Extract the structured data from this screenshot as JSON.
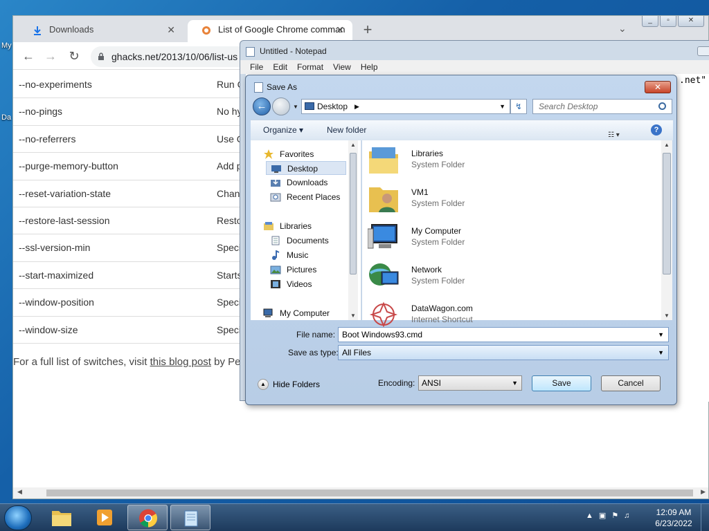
{
  "desktop": {
    "labels": [
      "My",
      "Da"
    ]
  },
  "browser": {
    "tabs": [
      {
        "title": "Downloads",
        "icon": "download-icon"
      },
      {
        "title": "List of Google Chrome comman",
        "icon": "ghacks-favicon"
      }
    ],
    "url": "ghacks.net/2013/10/06/list-us",
    "table": [
      {
        "switch": "--no-experiments",
        "desc": "Run C"
      },
      {
        "switch": "--no-pings",
        "desc": "No hy"
      },
      {
        "switch": "--no-referrers",
        "desc": "Use C"
      },
      {
        "switch": "--purge-memory-button",
        "desc": "Add p"
      },
      {
        "switch": "--reset-variation-state",
        "desc": "Chan"
      },
      {
        "switch": "--restore-last-session",
        "desc": "Resto"
      },
      {
        "switch": "--ssl-version-min",
        "desc": "Speci"
      },
      {
        "switch": "--start-maximized",
        "desc": "Starts"
      },
      {
        "switch": "--window-position",
        "desc": "Speci"
      },
      {
        "switch": "--window-size",
        "desc": "Speci"
      }
    ],
    "footer": {
      "prefix": "For a full list of switches, visit ",
      "link": "this blog post",
      "suffix": " by Pe"
    }
  },
  "notepad": {
    "title": "Untitled - Notepad",
    "menu": [
      "File",
      "Edit",
      "Format",
      "View",
      "Help"
    ],
    "content_fragment": ".net\""
  },
  "save_dialog": {
    "title": "Save As",
    "location": "Desktop",
    "search_placeholder": "Search Desktop",
    "organize": "Organize",
    "new_folder": "New folder",
    "nav": {
      "favorites": "Favorites",
      "fav_items": [
        "Desktop",
        "Downloads",
        "Recent Places"
      ],
      "libraries": "Libraries",
      "lib_items": [
        "Documents",
        "Music",
        "Pictures",
        "Videos"
      ],
      "computer": "My Computer"
    },
    "items": [
      {
        "name": "Libraries",
        "type": "System Folder",
        "icon": "libraries-icon"
      },
      {
        "name": "VM1",
        "type": "System Folder",
        "icon": "user-folder-icon"
      },
      {
        "name": "My Computer",
        "type": "System Folder",
        "icon": "computer-icon"
      },
      {
        "name": "Network",
        "type": "System Folder",
        "icon": "network-icon"
      },
      {
        "name": "DataWagon.com",
        "type": "Internet Shortcut",
        "icon": "shortcut-icon"
      }
    ],
    "file_name_label": "File name:",
    "file_name": "Boot Windows93.cmd",
    "save_type_label": "Save as type:",
    "save_type": "All Files",
    "hide_folders": "Hide Folders",
    "encoding_label": "Encoding:",
    "encoding": "ANSI",
    "save": "Save",
    "cancel": "Cancel"
  },
  "taskbar": {
    "time": "12:09 AM",
    "date": "6/23/2022"
  }
}
